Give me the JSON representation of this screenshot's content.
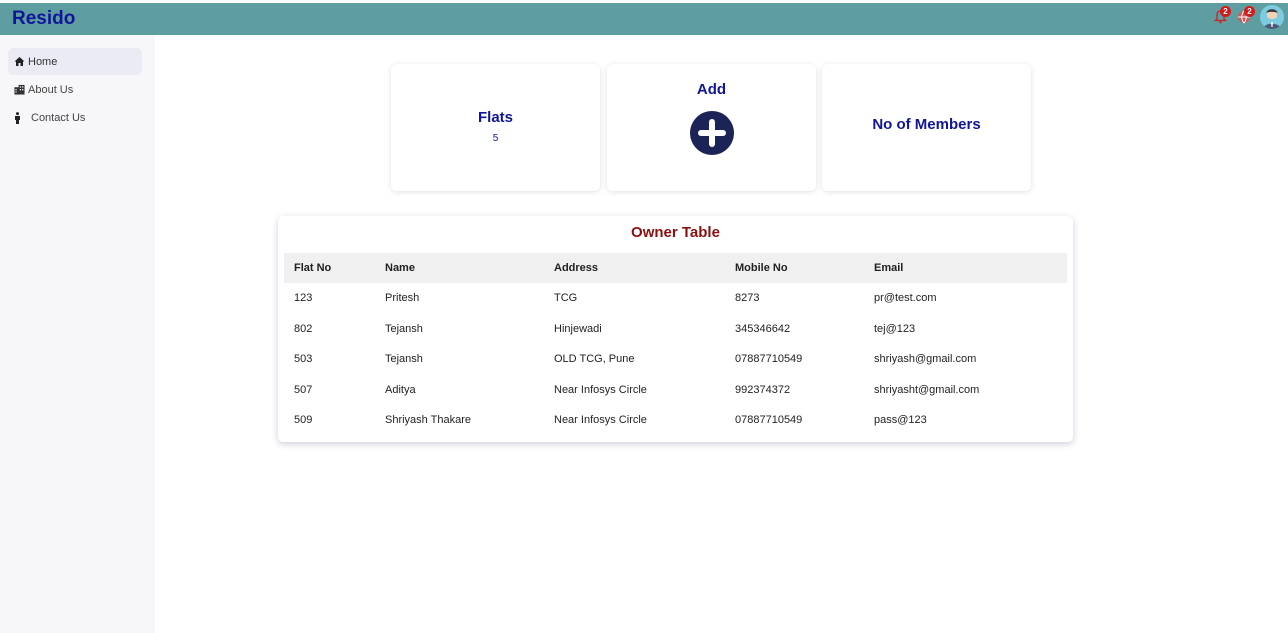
{
  "header": {
    "brand": "Resido",
    "notification_count": "2",
    "alert_count": "2"
  },
  "sidebar": {
    "items": [
      {
        "label": "Home",
        "icon": "home-icon",
        "active": true
      },
      {
        "label": "About Us",
        "icon": "building-icon",
        "active": false
      },
      {
        "label": "Contact Us",
        "icon": "person-icon",
        "active": false
      }
    ]
  },
  "cards": {
    "flats": {
      "title": "Flats",
      "value": "5"
    },
    "add": {
      "title": "Add",
      "icon": "plus-circle-icon"
    },
    "members": {
      "title": "No of Members"
    }
  },
  "owner_table": {
    "title": "Owner Table",
    "columns": [
      "Flat No",
      "Name",
      "Address",
      "Mobile No",
      "Email"
    ],
    "rows": [
      [
        "123",
        "Pritesh",
        "TCG",
        "8273",
        "pr@test.com"
      ],
      [
        "802",
        "Tejansh",
        "Hinjewadi",
        "345346642",
        "tej@123"
      ],
      [
        "503",
        "Tejansh",
        "OLD TCG, Pune",
        "07887710549",
        "shriyash@gmail.com"
      ],
      [
        "507",
        "Aditya",
        "Near Infosys Circle",
        "992374372",
        "shriyasht@gmail.com"
      ],
      [
        "509",
        "Shriyash Thakare",
        "Near Infosys Circle",
        "07887710549",
        "pass@123"
      ]
    ]
  },
  "colors": {
    "topbar": "#5f9ea0",
    "brand": "#10169a",
    "table_title": "#8b1010",
    "add_icon": "#1c2457"
  }
}
